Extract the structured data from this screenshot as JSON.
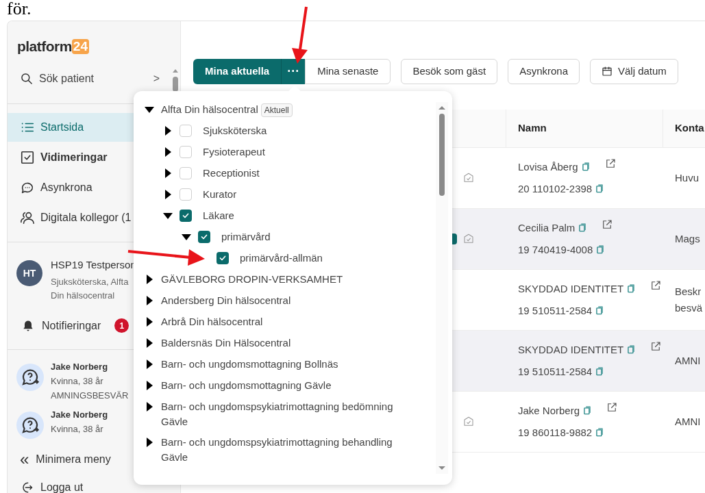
{
  "document_text": "för.",
  "sidebar": {
    "logo": {
      "text": "platform",
      "badge": "24"
    },
    "search": {
      "label": "Sök patient",
      "chevron": ">"
    },
    "nav": [
      {
        "label": "Startsida",
        "selected": true,
        "bold": false
      },
      {
        "label": "Vidimeringar",
        "selected": false,
        "bold": true
      },
      {
        "label": "Asynkrona",
        "selected": false,
        "bold": false
      },
      {
        "label": "Digitala kollegor (1",
        "selected": false,
        "bold": false
      }
    ],
    "profile": {
      "initials": "HT",
      "name": "HSP19 Testperson",
      "role": "Sjuksköterska, Alfta Din hälsocentral"
    },
    "notifications": {
      "label": "Notifieringar",
      "count": "1"
    },
    "patients": [
      {
        "name": "Jake Norberg",
        "info": "Kvinna, 38 år",
        "reason": "AMNINGSBESVÄR"
      },
      {
        "name": "Jake Norberg",
        "info": "Kvinna, 38 år"
      }
    ],
    "minimize": {
      "icon": "«",
      "label": "Minimera meny"
    },
    "logout": {
      "label": "Logga ut"
    }
  },
  "toolbar": {
    "group": [
      {
        "label": "Mina aktuella",
        "kind": "primary"
      },
      {
        "label": "···",
        "kind": "more"
      },
      {
        "label": "Mina senaste",
        "kind": "secondary"
      }
    ],
    "buttons": [
      {
        "label": "Besök som gäst",
        "icon": false
      },
      {
        "label": "Asynkrona",
        "icon": false
      },
      {
        "label": "Välj datum",
        "icon": true
      }
    ]
  },
  "table": {
    "columns": [
      "Namn",
      "Konta"
    ],
    "rows": [
      {
        "tagged": false,
        "verified": true,
        "shaded": false,
        "name": "Lovisa Åberg",
        "id": "20 110102-2398",
        "contact": [
          "Huvu"
        ]
      },
      {
        "tagged": true,
        "verified": true,
        "shaded": true,
        "name": "Cecilia Palm",
        "id": "19 740419-4008",
        "contact": [
          "Mags"
        ]
      },
      {
        "tagged": false,
        "verified": false,
        "shaded": false,
        "name": "SKYDDAD IDENTITET",
        "id": "19 510511-2584",
        "contact": [
          "Beskr",
          "besvä"
        ]
      },
      {
        "tagged": false,
        "verified": false,
        "shaded": true,
        "name": "SKYDDAD IDENTITET",
        "id": "19 510511-2584",
        "contact": [
          "AMNI"
        ]
      },
      {
        "tagged": false,
        "verified": true,
        "shaded": false,
        "name": "Jake Norberg",
        "id": "19 860118-9882",
        "contact": [
          "AMNI"
        ]
      }
    ]
  },
  "dropdown": {
    "tree": [
      {
        "label": "Alfta Din hälsocentral",
        "badge": "Aktuell",
        "expanded": true,
        "children": [
          {
            "label": "Sjuksköterska",
            "expanded": false,
            "checked": false
          },
          {
            "label": "Fysioterapeut",
            "expanded": false,
            "checked": false
          },
          {
            "label": "Receptionist",
            "expanded": false,
            "checked": false
          },
          {
            "label": "Kurator",
            "expanded": false,
            "checked": false
          },
          {
            "label": "Läkare",
            "expanded": true,
            "checked": true,
            "children": [
              {
                "label": "primärvård",
                "expanded": true,
                "checked": true,
                "children": [
                  {
                    "label": "primärvård-allmän",
                    "checked": true
                  }
                ]
              }
            ]
          }
        ]
      },
      {
        "label": "GÄVLEBORG DROPIN-VERKSAMHET",
        "expanded": false
      },
      {
        "label": "Andersberg Din hälsocentral",
        "expanded": false
      },
      {
        "label": "Arbrå Din hälsocentral",
        "expanded": false
      },
      {
        "label": "Baldersnäs Din Hälsocentral",
        "expanded": false
      },
      {
        "label": "Barn- och ungdomsmottagning Bollnäs",
        "expanded": false
      },
      {
        "label": "Barn- och ungdomsmottagning Gävle",
        "expanded": false
      },
      {
        "label": "Barn- och ungdomspsykiatrimottagning bedömning Gävle",
        "expanded": false
      },
      {
        "label": "Barn- och ungdomspsykiatrimottagning behandling Gävle",
        "expanded": false
      }
    ]
  }
}
